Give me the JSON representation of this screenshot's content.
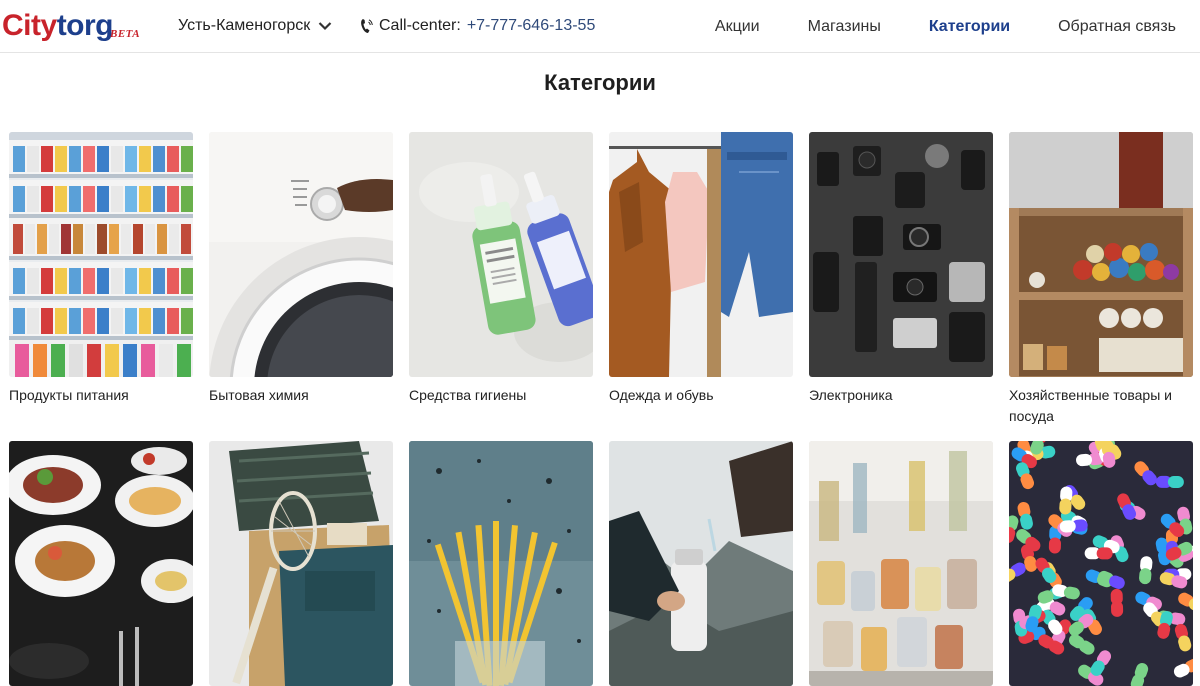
{
  "header": {
    "logo": {
      "city": "City",
      "torg": "torg",
      "beta": "BETA"
    },
    "city_selector": {
      "label": "Усть-Каменогорск",
      "icon": "chevron-down-icon"
    },
    "callcenter": {
      "label": "Call-center:",
      "phone": "+7-777-646-13-55",
      "icon": "phone-icon"
    },
    "nav": [
      {
        "label": "Акции",
        "active": false
      },
      {
        "label": "Магазины",
        "active": false
      },
      {
        "label": "Категории",
        "active": true
      },
      {
        "label": "Обратная связь",
        "active": false
      }
    ]
  },
  "page": {
    "title": "Категории"
  },
  "categories": [
    {
      "label": "Продукты питания",
      "image": "supermarket-shelves"
    },
    {
      "label": "Бытовая химия",
      "image": "washing-machine"
    },
    {
      "label": "Средства гигиены",
      "image": "spray-bottles"
    },
    {
      "label": "Одежда и обувь",
      "image": "clothes-rack"
    },
    {
      "label": "Электроника",
      "image": "camera-gear"
    },
    {
      "label": "Хозяйственные товары и посуда",
      "image": "wooden-shelf-crafts"
    },
    {
      "label": "",
      "image": "restaurant-dishes"
    },
    {
      "label": "",
      "image": "backpack-racket"
    },
    {
      "label": "",
      "image": "yellow-pencils"
    },
    {
      "label": "",
      "image": "water-bottle-mountains"
    },
    {
      "label": "",
      "image": "perfume-bottles"
    },
    {
      "label": "",
      "image": "colorful-pills"
    }
  ]
}
